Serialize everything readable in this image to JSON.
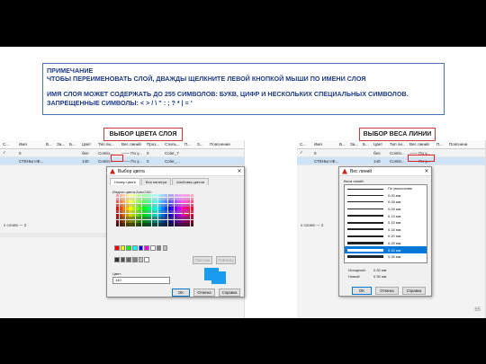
{
  "note": {
    "title": "ПРИМЕЧАНИЕ",
    "line1": "ЧТОБЫ ПЕРЕИМЕНОВАТЬ СЛОЙ, ДВАЖДЫ ЩЕЛКНИТЕ ЛЕВОЙ КНОПКОЙ МЫШИ ПО ИМЕНИ СЛОЯ",
    "line2": "ИМЯ СЛОЯ МОЖЕТ СОДЕРЖАТЬ ДО 255 СИМВОЛОВ: БУКВ, ЦИФР И НЕСКОЛЬКИХ СПЕЦИАЛЬНЫХ СИМВОЛОВ.",
    "line3": "ЗАПРЕЩЕННЫЕ СИМВОЛЫ: < > / \\ \" : ; ? * | = '"
  },
  "callouts": {
    "left": "ВЫБОР ЦВЕТА СЛОЯ",
    "right": "ВЫБОР ВЕСА ЛИНИИ"
  },
  "layer_table": {
    "headers_left": [
      "С...",
      "Имя",
      "В...",
      "За...",
      "Б...",
      "Цвет",
      "Тип ли...",
      "Вес линий",
      "Проз...",
      "Стиль...",
      "П...",
      "З...",
      "Пояснение"
    ],
    "headers_right": [
      "С...",
      "Имя",
      "В...",
      "За...",
      "Б...",
      "Цвет",
      "Тип ли...",
      "Вес линий",
      "П...",
      "Пояснени"
    ],
    "rows": [
      {
        "status": "✓",
        "name": "0",
        "color": "бел",
        "linetype": "Contin...",
        "weight": "—— По у...",
        "transp": "0",
        "style": "Color_7"
      },
      {
        "status": "",
        "name": "СТЕНЫ НЕ...",
        "color": "140",
        "linetype": "Contin...",
        "weight": "—— По у...",
        "transp": "0",
        "style": "Color_..."
      }
    ],
    "footer": "х слоев — 2",
    "footer_right": "х слоев — 2"
  },
  "color_dialog": {
    "title": "Выбор цвета",
    "tabs": [
      "Номер цвета",
      "Вся палитра",
      "Альбомы цветов"
    ],
    "index_label": "Индекс цвета AutoCAD:",
    "bylayer": "ПоСлою",
    "byblock": "ПоБлоку",
    "color_label": "Цвет:",
    "color_value": "140",
    "ok": "OK",
    "cancel": "Отмена",
    "help": "Справка",
    "accent": "#1a9bef"
  },
  "weight_dialog": {
    "title": "Вес линий",
    "list_label": "Веса линий:",
    "items": [
      "По умолчанию",
      "0.00 мм",
      "0.05 мм",
      "0.09 мм",
      "0.13 мм",
      "0.15 мм",
      "0.18 мм",
      "0.20 мм",
      "0.25 мм",
      "0.30 мм",
      "0.35 мм"
    ],
    "selected_index": 9,
    "original_label": "Исходный:",
    "original_value": "0.30 мм",
    "new_label": "Новый:",
    "new_value": "0.30 мм",
    "ok": "OK",
    "cancel": "Отмена",
    "help": "Справка"
  },
  "page_number": "65"
}
